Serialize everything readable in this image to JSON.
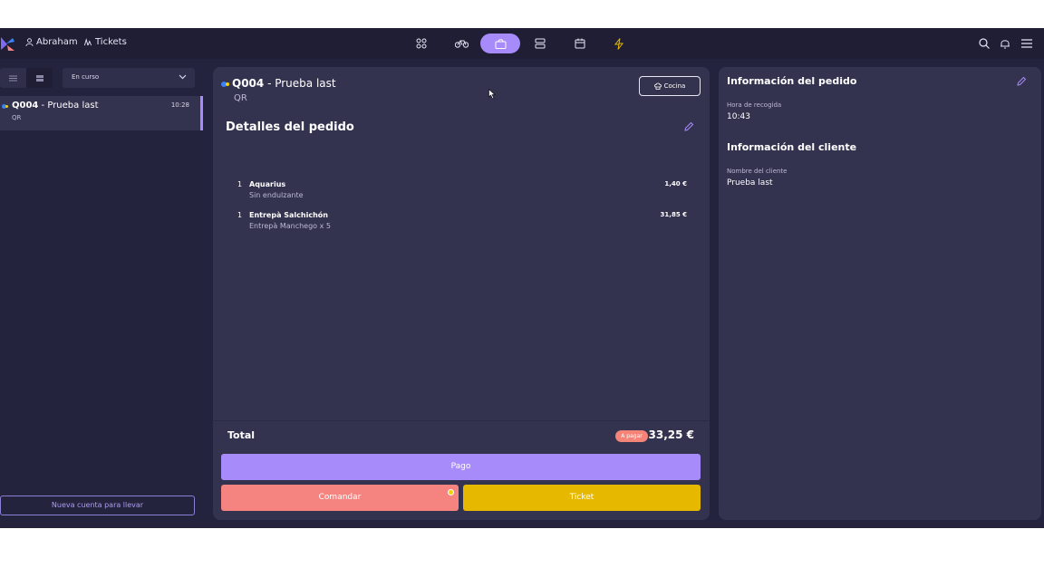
{
  "topbar": {
    "user_name": "Abraham",
    "tickets_label": "Tickets",
    "nav": [
      {
        "icon": "grid-icon",
        "active": false
      },
      {
        "icon": "bike-icon",
        "active": false
      },
      {
        "icon": "shopping-bag-icon",
        "active": true
      },
      {
        "icon": "server-icon",
        "active": false
      },
      {
        "icon": "calendar-icon",
        "active": false
      },
      {
        "icon": "lightning-icon",
        "active": false
      }
    ],
    "right_icons": [
      "search-icon",
      "bell-icon",
      "menu-icon"
    ]
  },
  "sidebar": {
    "status_filter": "En curso",
    "orders": [
      {
        "code": "Q004",
        "name": "Prueba last",
        "source": "QR",
        "time": "10:28"
      }
    ],
    "new_account_label": "Nueva cuenta para llevar"
  },
  "order": {
    "code": "Q004",
    "separator": " - ",
    "name": "Prueba last",
    "source": "QR",
    "kitchen_label": "Cocina",
    "details_title": "Detalles del pedido",
    "items": [
      {
        "qty": "1",
        "name": "Aquarius",
        "modifier": "Sin endulzante",
        "price": "1,40 €"
      },
      {
        "qty": "1",
        "name": "Entrepà Salchichón",
        "modifier": "Entrepà Manchego x 5",
        "price": "31,85 €"
      }
    ],
    "total_label": "Total",
    "pay_status": "A pagar",
    "total_value": "33,25 €",
    "pay_button": "Pago",
    "order_button": "Comandar",
    "ticket_button": "Ticket"
  },
  "info": {
    "order_info_title": "Información del pedido",
    "pickup_label": "Hora de recogida",
    "pickup_time": "10:43",
    "client_info_title": "Información del cliente",
    "client_name_label": "Nombre del cliente",
    "client_name": "Prueba last"
  },
  "colors": {
    "accent": "#a78bfa",
    "order_button": "#f58480",
    "ticket_button": "#e6b800",
    "pay_badge": "#f48478"
  }
}
